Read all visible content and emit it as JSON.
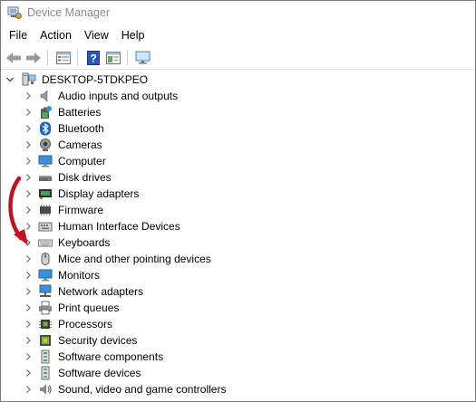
{
  "window": {
    "title": "Device Manager",
    "icon": "device-manager-icon"
  },
  "menu": [
    "File",
    "Action",
    "View",
    "Help"
  ],
  "toolbar": {
    "buttons": [
      "back-arrow-icon",
      "forward-arrow-icon",
      "properties-icon",
      "help-icon",
      "update-driver-icon",
      "monitor-scan-icon"
    ]
  },
  "tree": {
    "root": "DESKTOP-5TDKPEO",
    "categories": [
      {
        "label": "Audio inputs and outputs",
        "icon": "speaker-icon"
      },
      {
        "label": "Batteries",
        "icon": "battery-icon"
      },
      {
        "label": "Bluetooth",
        "icon": "bluetooth-icon"
      },
      {
        "label": "Cameras",
        "icon": "camera-icon"
      },
      {
        "label": "Computer",
        "icon": "computer-icon"
      },
      {
        "label": "Disk drives",
        "icon": "disk-drive-icon"
      },
      {
        "label": "Display adapters",
        "icon": "display-adapter-icon"
      },
      {
        "label": "Firmware",
        "icon": "firmware-icon"
      },
      {
        "label": "Human Interface Devices",
        "icon": "hid-icon"
      },
      {
        "label": "Keyboards",
        "icon": "keyboard-icon"
      },
      {
        "label": "Mice and other pointing devices",
        "icon": "mouse-icon"
      },
      {
        "label": "Monitors",
        "icon": "monitor-icon"
      },
      {
        "label": "Network adapters",
        "icon": "network-adapter-icon"
      },
      {
        "label": "Print queues",
        "icon": "printer-icon"
      },
      {
        "label": "Processors",
        "icon": "processor-icon"
      },
      {
        "label": "Security devices",
        "icon": "security-device-icon"
      },
      {
        "label": "Software components",
        "icon": "software-component-icon"
      },
      {
        "label": "Software devices",
        "icon": "software-device-icon"
      },
      {
        "label": "Sound, video and game controllers",
        "icon": "sound-controller-icon"
      }
    ]
  },
  "annotation": {
    "arrow_color": "#c1121f"
  }
}
